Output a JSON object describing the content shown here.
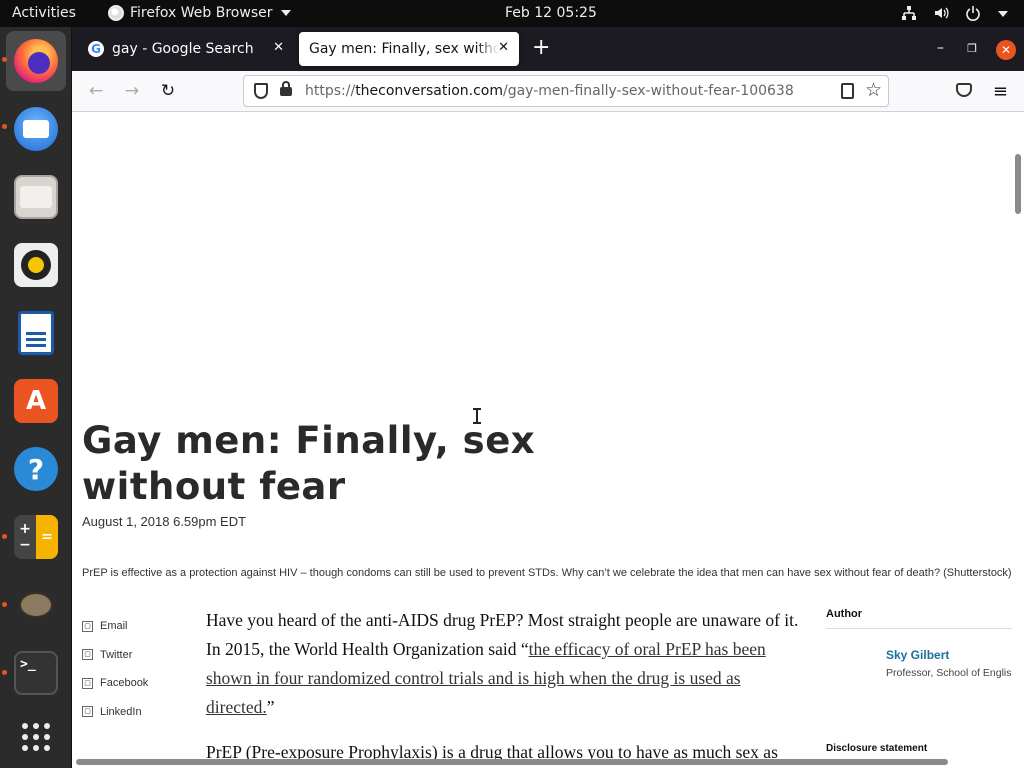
{
  "system_bar": {
    "activities_label": "Activities",
    "app_menu_label": "Firefox Web Browser",
    "clock": "Feb 12  05:25"
  },
  "dock": {
    "items": [
      {
        "name": "firefox",
        "active": true
      },
      {
        "name": "thunderbird"
      },
      {
        "name": "files"
      },
      {
        "name": "rhythmbox"
      },
      {
        "name": "libreoffice-writer"
      },
      {
        "name": "ubuntu-software"
      },
      {
        "name": "help"
      },
      {
        "name": "calculator"
      },
      {
        "name": "gimp"
      },
      {
        "name": "terminal"
      },
      {
        "name": "show-applications"
      }
    ]
  },
  "browser": {
    "tabs": [
      {
        "title": "gay - Google Search",
        "favicon": "G",
        "active": false
      },
      {
        "title": "Gay men: Finally, sex without fear",
        "active": true
      }
    ],
    "url": {
      "scheme": "https://",
      "domain": "theconversation.com",
      "path": "/gay-men-finally-sex-without-fear-100638"
    }
  },
  "article": {
    "title": "Gay men: Finally, sex without fear",
    "date": "August 1, 2018 6.59pm EDT",
    "caption": "PrEP is effective as a protection against HIV – though condoms can still be used to prevent STDs. Why can’t we celebrate the idea that men can have sex without fear of death? (Shutterstock)",
    "share": [
      "Email",
      "Twitter",
      "Facebook",
      "LinkedIn"
    ],
    "p1_before": "Have you heard of the anti-AIDS drug PrEP? Most straight people are unaware of it. In 2015, the World Health Organization said “",
    "p1_link": "the efficacy of oral PrEP has been shown in four randomized control trials and is high when the drug is used as directed.",
    "p1_after": "”",
    "p2": "PrEP (Pre-exposure Prophylaxis) is a drug that allows you to have as much sex as",
    "author": {
      "heading": "Author",
      "name": "Sky Gilbert",
      "role": "Professor, School of English and Theatre Studies, University of Guelph",
      "disclosure": "Disclosure statement"
    }
  },
  "colors": {
    "ubuntu_orange": "#e95420",
    "author_link": "#1a6fa0"
  }
}
